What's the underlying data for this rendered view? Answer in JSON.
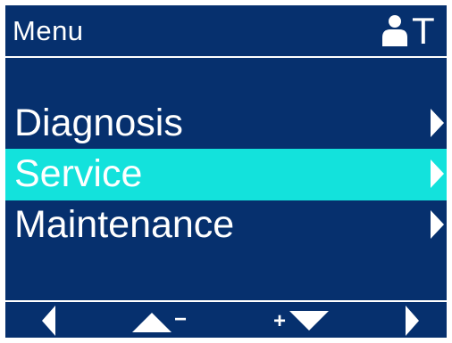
{
  "header": {
    "title": "Menu",
    "user_icon": "user-icon",
    "mode_letter": "T"
  },
  "menu": {
    "items": [
      {
        "label": "Diagnosis",
        "selected": false,
        "icon": "chevron-right-icon"
      },
      {
        "label": "Service",
        "selected": true,
        "icon": "chevron-right-icon"
      },
      {
        "label": "Maintenance",
        "selected": false,
        "icon": "chevron-right-icon"
      }
    ]
  },
  "footer": {
    "keys": [
      {
        "name": "back",
        "icon": "triangle-left-icon"
      },
      {
        "name": "up-minus",
        "icon": "triangle-up-icon",
        "sign": "−"
      },
      {
        "name": "plus-down",
        "icon": "triangle-down-icon",
        "sign": "+"
      },
      {
        "name": "enter",
        "icon": "triangle-right-icon"
      }
    ]
  },
  "colors": {
    "background": "#06306e",
    "selection": "#13e2dc",
    "foreground": "#ffffff",
    "frame": "#ffffff"
  }
}
